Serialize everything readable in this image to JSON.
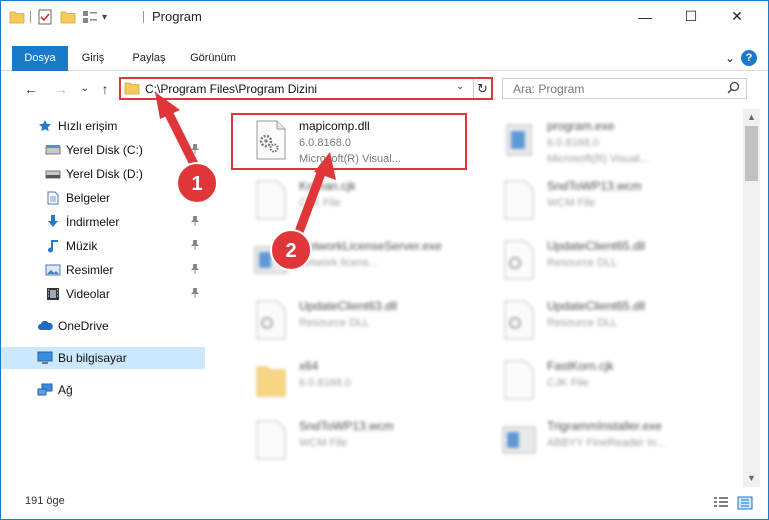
{
  "window": {
    "title": "Program",
    "controls": {
      "minimize": "—",
      "maximize": "☐",
      "close": "✕"
    }
  },
  "ribbon": {
    "tabs": [
      {
        "label": "Dosya",
        "active": true
      },
      {
        "label": "Giriş",
        "active": false
      },
      {
        "label": "Paylaş",
        "active": false
      },
      {
        "label": "Görünüm",
        "active": false
      }
    ],
    "collapse": "⌄",
    "help": "?"
  },
  "nav": {
    "back": "←",
    "forward": "→",
    "recent": "⌄",
    "up": "↑"
  },
  "address": {
    "path": "C:\\Program Files\\Program Dizini",
    "dropdown": "⌄",
    "refresh": "↻"
  },
  "search": {
    "placeholder": "Ara: Program",
    "icon": "search-icon"
  },
  "sidebar": {
    "items": [
      {
        "label": "Hızlı erişim",
        "icon": "star-icon",
        "pinned": false
      },
      {
        "label": "Yerel Disk (C:)",
        "icon": "drive-icon",
        "pinned": true
      },
      {
        "label": "Yerel Disk (D:)",
        "icon": "drive-icon",
        "pinned": false
      },
      {
        "label": "Belgeler",
        "icon": "documents-icon",
        "pinned": true
      },
      {
        "label": "İndirmeler",
        "icon": "download-icon",
        "pinned": true
      },
      {
        "label": "Müzik",
        "icon": "music-icon",
        "pinned": true
      },
      {
        "label": "Resimler",
        "icon": "pictures-icon",
        "pinned": true
      },
      {
        "label": "Videolar",
        "icon": "videos-icon",
        "pinned": true
      },
      {
        "label": "OneDrive",
        "icon": "cloud-icon",
        "pinned": false
      },
      {
        "label": "Bu bilgisayar",
        "icon": "computer-icon",
        "pinned": false,
        "selected": true
      },
      {
        "label": "Ağ",
        "icon": "network-icon",
        "pinned": false
      }
    ],
    "pin_glyph": "📌"
  },
  "files": [
    {
      "name": "mapicomp.dll",
      "line2": "6.0.8168.0",
      "line3": "Microsoft(R) Visual...",
      "icon": "dll-icon",
      "clear": true
    },
    {
      "name": "program.exe",
      "line2": "6.0.8168.0",
      "line3": "Microsoft(R) Visual...",
      "icon": "exe-icon",
      "clear": false
    },
    {
      "name": "Korean.cjk",
      "line2": "CJK File",
      "line3": "",
      "icon": "file-icon",
      "clear": false
    },
    {
      "name": "SndToWP13.wcm",
      "line2": "WCM File",
      "line3": "",
      "icon": "file-icon",
      "clear": false
    },
    {
      "name": "NetworkLicenseServer.exe",
      "line2": "network licens...",
      "line3": "",
      "icon": "exe-icon",
      "clear": false
    },
    {
      "name": "UpdateClient65.dll",
      "line2": "Resource DLL",
      "line3": "",
      "icon": "dll-icon",
      "clear": false
    },
    {
      "name": "UpdateClient63.dll",
      "line2": "Resource DLL",
      "line3": "",
      "icon": "dll-icon",
      "clear": false
    },
    {
      "name": "UpdateClient65.dll",
      "line2": "Resource DLL",
      "line3": "",
      "icon": "dll-icon",
      "clear": false
    },
    {
      "name": "x64",
      "line2": "6.0.8168.0",
      "line3": "",
      "icon": "folder-icon",
      "clear": false
    },
    {
      "name": "FastKorn.cjk",
      "line2": "CJK File",
      "line3": "",
      "icon": "file-icon",
      "clear": false
    },
    {
      "name": "SndToWP13.wcm",
      "line2": "WCM File",
      "line3": "",
      "icon": "file-icon",
      "clear": false
    },
    {
      "name": "TrigrammInstaller.exe",
      "line2": "ABBYY FineReader In...",
      "line3": "",
      "icon": "exe-icon",
      "clear": false
    }
  ],
  "annotations": {
    "badge1": "1",
    "badge2": "2"
  },
  "status": {
    "count": "191 öge"
  },
  "colors": {
    "accent": "#1979ca",
    "annotation": "#e0363a",
    "selected": "#cce8ff"
  }
}
